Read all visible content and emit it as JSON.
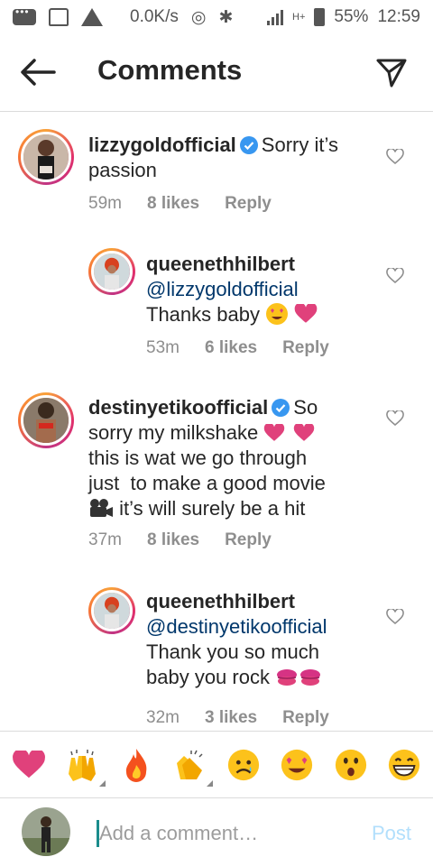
{
  "status_bar": {
    "speed": "0.0K/s",
    "network": "H+",
    "battery": "55%",
    "time": "12:59"
  },
  "header": {
    "title": "Comments",
    "back_icon": "arrow-left-icon",
    "send_icon": "paper-plane-icon"
  },
  "comments": [
    {
      "username": "lizzygoldofficial",
      "verified": true,
      "text": "Sorry it’s passion",
      "time": "59m",
      "likes": "8 likes",
      "reply": "Reply",
      "is_reply": false
    },
    {
      "username": "queenethhilbert",
      "verified": false,
      "mention": "@lizzygoldofficial",
      "text": "Thanks baby",
      "time": "53m",
      "likes": "6 likes",
      "reply": "Reply",
      "is_reply": true
    },
    {
      "username": "destinyetikoofficial",
      "verified": true,
      "text_part1": "So",
      "text_part2": "sorry my milkshake",
      "text_part3": "this is wat we go through",
      "text_part4": "just  to make a good movie",
      "text_part5": "it’s will surely be a hit",
      "time": "37m",
      "likes": "8 likes",
      "reply": "Reply",
      "is_reply": false
    },
    {
      "username": "queenethhilbert",
      "verified": false,
      "mention": "@destinyetikoofficial",
      "text_line1": "Thank you so much",
      "text_line2": "baby you rock",
      "time": "32m",
      "likes": "3 likes",
      "reply": "Reply",
      "is_reply": true
    }
  ],
  "emoji_bar": [
    "heart",
    "raised-hands",
    "fire",
    "clapping-hands",
    "sad-face",
    "heart-eyes",
    "surprised-face",
    "grinning-face"
  ],
  "input": {
    "placeholder": "Add a comment…",
    "post_label": "Post"
  },
  "colors": {
    "verified_blue": "#3897f0",
    "mention_blue": "#00376b",
    "heart_pink": "#e0417b",
    "post_disabled": "#b2dffc"
  }
}
